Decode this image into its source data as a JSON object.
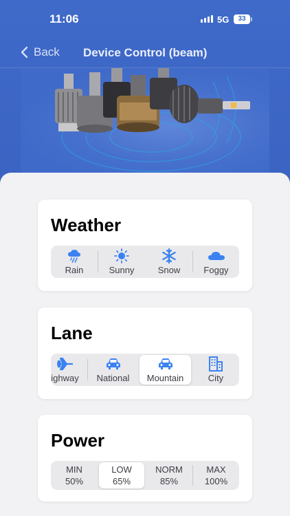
{
  "status": {
    "time": "11:06",
    "network": "5G",
    "battery": "33"
  },
  "nav": {
    "back_label": "Back",
    "title": "Device Control (beam)"
  },
  "weather": {
    "title": "Weather",
    "options": [
      {
        "label": "Rain",
        "icon": "rain-cloud-icon"
      },
      {
        "label": "Sunny",
        "icon": "sun-icon"
      },
      {
        "label": "Snow",
        "icon": "snowflake-icon"
      },
      {
        "label": "Foggy",
        "icon": "cloud-icon"
      }
    ]
  },
  "lane": {
    "title": "Lane",
    "options": [
      {
        "label": "ighway",
        "icon": "airplane-icon"
      },
      {
        "label": "National",
        "icon": "car-icon"
      },
      {
        "label": "Mountain",
        "icon": "car-icon",
        "selected": true
      },
      {
        "label": "City",
        "icon": "buildings-icon"
      }
    ]
  },
  "power": {
    "title": "Power",
    "options": [
      {
        "label": "MIN",
        "value": "50%"
      },
      {
        "label": "LOW",
        "value": "65%",
        "selected": true
      },
      {
        "label": "NORM",
        "value": "85%"
      },
      {
        "label": "MAX",
        "value": "100%"
      }
    ]
  },
  "colors": {
    "accent": "#3f6ac9",
    "icon": "#3b82f0",
    "sheet": "#f2f2f4"
  }
}
